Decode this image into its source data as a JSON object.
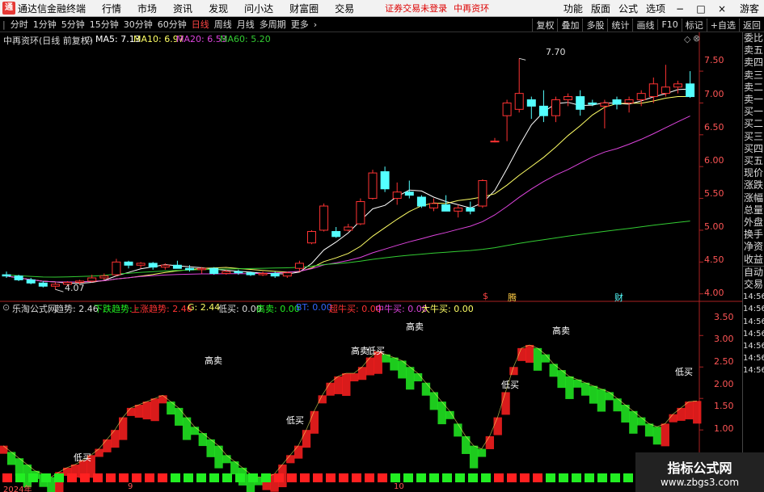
{
  "app": {
    "logo_text": "通",
    "title": "通达信金融终端"
  },
  "menu": [
    "行情",
    "市场",
    "资讯",
    "发现",
    "问小达",
    "财富圈",
    "交易"
  ],
  "warning": "证券交易未登录",
  "stock_name": "中再资环",
  "menu_right": [
    "功能",
    "版面",
    "公式",
    "选项"
  ],
  "window_btns": [
    "−",
    "□",
    "×"
  ],
  "user": "游客",
  "periods": [
    "分时",
    "1分钟",
    "5分钟",
    "15分钟",
    "30分钟",
    "60分钟",
    "日线",
    "周线",
    "月线",
    "多周期",
    "更多"
  ],
  "active_period": "日线",
  "toolbar_right": [
    "复权",
    "叠加",
    "多股",
    "统计",
    "画线",
    "F10",
    "标记",
    "+自选",
    "返回"
  ],
  "chart_header": {
    "title": "中再资环(日线 前复权)",
    "ma5": "MA5: 7.13",
    "ma10": "MA10: 6.97",
    "ma20": "MA20: 6.53",
    "ma60": "MA60: 5.20"
  },
  "price_axis": [
    "7.50",
    "7.00",
    "6.50",
    "6.00",
    "5.50",
    "5.00",
    "4.50",
    "4.00"
  ],
  "annotations": {
    "high": "7.70",
    "low": "4.07",
    "ev1": "$",
    "ev2": "腾",
    "ev3": "财"
  },
  "indicator_header": {
    "name": "乐淘公式网",
    "trend": "趋势: 2.46",
    "down": "下跌趋势: -",
    "up": "上涨趋势: 2.46",
    "g": "G: 2.44",
    "lowbuy": "低买: 0.00",
    "highsell": "高卖: 0.00",
    "bt": "BT: 0.00",
    "super": "超牛买: 0.00",
    "mid": "中牛买: 0.00",
    "big": "大牛买: 0.00"
  },
  "ind_axis": [
    "3.50",
    "3.00",
    "2.50",
    "2.00",
    "1.50",
    "1.00"
  ],
  "signals": {
    "buy": "低买",
    "sell": "高卖"
  },
  "dates": [
    "2024年",
    "9",
    "10"
  ],
  "right_panel": [
    "委比",
    "卖五",
    "卖四",
    "卖三",
    "卖二",
    "卖一",
    "买一",
    "买二",
    "买三",
    "买四",
    "买五",
    "现价",
    "涨跌",
    "涨幅",
    "总量",
    "外盘",
    "换手",
    "净资",
    "收益",
    "自动",
    "交易",
    "14:56",
    "14:56",
    "14:56",
    "14:56",
    "14:56",
    "14:56",
    "14:56"
  ],
  "watermark": {
    "line1": "指标公式网",
    "line2": "www.zbgs3.com"
  },
  "colors": {
    "up": "#ff3333",
    "down": "#54ffff",
    "ma5": "#ffffff",
    "ma10": "#ffff66",
    "ma20": "#dd44dd",
    "ma60": "#33cc33",
    "trend_up": "#ff2020",
    "trend_down": "#22ee22"
  },
  "chart_data": [
    {
      "type": "candlestick",
      "title": "中再资环(日线 前复权)",
      "ohlc": [
        [
          4.3,
          4.35,
          4.25,
          4.28
        ],
        [
          4.28,
          4.3,
          4.2,
          4.22
        ],
        [
          4.22,
          4.25,
          4.15,
          4.17
        ],
        [
          4.17,
          4.2,
          4.1,
          4.12
        ],
        [
          4.12,
          4.18,
          4.07,
          4.15
        ],
        [
          4.15,
          4.2,
          4.12,
          4.18
        ],
        [
          4.18,
          4.22,
          4.15,
          4.2
        ],
        [
          4.2,
          4.3,
          4.18,
          4.25
        ],
        [
          4.25,
          4.32,
          4.22,
          4.28
        ],
        [
          4.3,
          4.55,
          4.28,
          4.5
        ],
        [
          4.5,
          4.52,
          4.4,
          4.45
        ],
        [
          4.45,
          4.5,
          4.4,
          4.48
        ],
        [
          4.48,
          4.5,
          4.38,
          4.42
        ],
        [
          4.42,
          4.48,
          4.38,
          4.45
        ],
        [
          4.45,
          4.52,
          4.4,
          4.4
        ],
        [
          4.4,
          4.45,
          4.35,
          4.38
        ],
        [
          4.38,
          4.42,
          4.32,
          4.4
        ],
        [
          4.4,
          4.42,
          4.3,
          4.32
        ],
        [
          4.32,
          4.38,
          4.3,
          4.35
        ],
        [
          4.35,
          4.38,
          4.3,
          4.33
        ],
        [
          4.33,
          4.35,
          4.28,
          4.3
        ],
        [
          4.3,
          4.35,
          4.28,
          4.32
        ],
        [
          4.32,
          4.35,
          4.25,
          4.28
        ],
        [
          4.28,
          4.35,
          4.25,
          4.33
        ],
        [
          4.4,
          4.52,
          4.35,
          4.48
        ],
        [
          4.8,
          5.0,
          4.78,
          4.98
        ],
        [
          5.0,
          5.42,
          4.98,
          5.38
        ],
        [
          4.98,
          5.05,
          4.88,
          4.9
        ],
        [
          5.0,
          5.1,
          4.98,
          5.05
        ],
        [
          5.1,
          5.5,
          5.08,
          5.45
        ],
        [
          5.5,
          5.95,
          5.48,
          5.9
        ],
        [
          5.92,
          6.0,
          5.6,
          5.65
        ],
        [
          5.5,
          5.75,
          5.4,
          5.6
        ],
        [
          5.6,
          5.78,
          5.5,
          5.55
        ],
        [
          5.52,
          5.55,
          5.35,
          5.38
        ],
        [
          5.35,
          5.5,
          5.3,
          5.42
        ],
        [
          5.4,
          5.55,
          5.3,
          5.3
        ],
        [
          5.3,
          5.4,
          5.2,
          5.35
        ],
        [
          5.35,
          5.45,
          5.25,
          5.3
        ],
        [
          5.38,
          5.8,
          5.35,
          5.78
        ],
        [
          6.4,
          6.45,
          6.38,
          6.4
        ],
        [
          6.8,
          7.05,
          6.4,
          7.0
        ],
        [
          6.9,
          7.7,
          6.85,
          7.15
        ],
        [
          7.05,
          7.1,
          6.75,
          6.95
        ],
        [
          6.95,
          7.2,
          6.7,
          6.8
        ],
        [
          6.8,
          7.1,
          6.7,
          7.05
        ],
        [
          7.05,
          7.15,
          6.95,
          7.1
        ],
        [
          7.1,
          7.2,
          6.8,
          6.9
        ],
        [
          7.0,
          7.05,
          6.95,
          6.98
        ],
        [
          6.95,
          7.05,
          6.6,
          7.0
        ],
        [
          7.05,
          7.1,
          6.9,
          6.98
        ],
        [
          7.0,
          7.1,
          6.85,
          7.05
        ],
        [
          7.05,
          7.2,
          6.95,
          7.15
        ],
        [
          7.1,
          7.4,
          7.0,
          7.3
        ],
        [
          7.15,
          7.6,
          7.1,
          7.25
        ],
        [
          7.25,
          7.35,
          7.15,
          7.3
        ],
        [
          7.3,
          7.5,
          7.08,
          7.1
        ]
      ],
      "ylim": [
        3.92,
        7.92
      ]
    },
    {
      "type": "area",
      "title": "乐淘公式网",
      "trend": [
        1.75,
        1.65,
        1.55,
        1.45,
        1.35,
        1.3,
        1.25,
        1.33,
        1.4,
        1.45,
        1.52,
        1.6,
        1.7,
        1.85,
        2.0,
        2.2,
        2.35,
        2.4,
        2.45,
        2.5,
        2.55,
        2.45,
        2.35,
        2.2,
        2.05,
        1.95,
        1.85,
        1.75,
        1.6,
        1.5,
        1.4,
        1.3,
        1.25,
        1.25,
        1.3,
        1.45,
        1.6,
        1.75,
        2.0,
        2.3,
        2.55,
        2.75,
        2.85,
        2.9,
        2.9,
        3.0,
        3.15,
        3.25,
        3.2,
        3.15,
        3.1,
        3.0,
        2.9,
        2.75,
        2.6,
        2.45,
        2.3,
        2.1,
        1.9,
        1.75,
        1.7,
        1.9,
        2.2,
        2.6,
        3.0,
        3.3,
        3.35,
        3.3,
        3.2,
        3.05,
        2.95,
        2.85,
        2.8,
        2.75,
        2.7,
        2.65,
        2.6,
        2.5,
        2.4,
        2.3,
        2.2,
        2.1,
        2.05,
        2.1,
        2.25,
        2.35,
        2.45,
        2.46
      ],
      "ylim": [
        0.95,
        3.85
      ]
    }
  ]
}
